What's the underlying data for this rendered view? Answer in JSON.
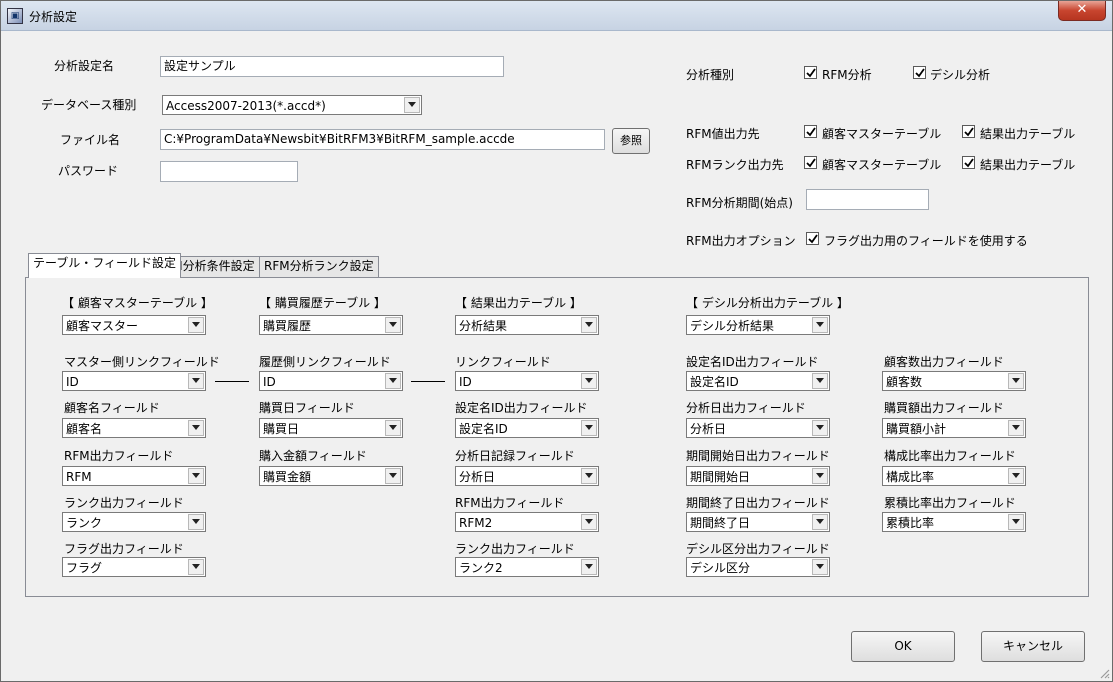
{
  "window": {
    "title": "分析設定"
  },
  "top": {
    "analysis_name": {
      "label": "分析設定名",
      "value": "設定サンプル"
    },
    "db_type": {
      "label": "データベース種別",
      "value": "Access2007-2013(*.accd*)"
    },
    "file_name": {
      "label": "ファイル名",
      "value": "C:¥ProgramData¥Newsbit¥BitRFM3¥BitRFM_sample.accde",
      "browse_label": "参照"
    },
    "password": {
      "label": "パスワード",
      "value": ""
    }
  },
  "right": {
    "analysis_type": {
      "label": "分析種別",
      "options": [
        {
          "label": "RFM分析",
          "checked": true
        },
        {
          "label": "デシル分析",
          "checked": true
        }
      ]
    },
    "rfm_value_output": {
      "label": "RFM値出力先",
      "options": [
        {
          "label": "顧客マスターテーブル",
          "checked": true
        },
        {
          "label": "結果出力テーブル",
          "checked": true
        }
      ]
    },
    "rfm_rank_output": {
      "label": "RFMランク出力先",
      "options": [
        {
          "label": "顧客マスターテーブル",
          "checked": true
        },
        {
          "label": "結果出力テーブル",
          "checked": true
        }
      ]
    },
    "rfm_period": {
      "label": "RFM分析期間(始点)",
      "value": ""
    },
    "rfm_option": {
      "label": "RFM出力オプション",
      "checkbox_label": "フラグ出力用のフィールドを使用する",
      "checked": true
    }
  },
  "tabs": [
    {
      "label": "テーブル・フィールド設定",
      "active": true
    },
    {
      "label": "RFM分析条件設定",
      "active": false
    },
    {
      "label": "RFM分析ランク設定",
      "active": false
    }
  ],
  "columns": {
    "customer": {
      "header": "【 顧客マスターテーブル 】",
      "table": "顧客マスター",
      "fields": [
        {
          "label": "マスター側リンクフィールド",
          "value": "ID"
        },
        {
          "label": "顧客名フィールド",
          "value": "顧客名"
        },
        {
          "label": "RFM出力フィールド",
          "value": "RFM"
        },
        {
          "label": "ランク出力フィールド",
          "value": "ランク"
        },
        {
          "label": "フラグ出力フィールド",
          "value": "フラグ"
        }
      ]
    },
    "purchase": {
      "header": "【 購買履歴テーブル 】",
      "table": "購買履歴",
      "fields": [
        {
          "label": "履歴側リンクフィールド",
          "value": "ID"
        },
        {
          "label": "購買日フィールド",
          "value": "購買日"
        },
        {
          "label": "購入金額フィールド",
          "value": "購買金額"
        }
      ]
    },
    "result": {
      "header": "【 結果出力テーブル 】",
      "table": "分析結果",
      "fields": [
        {
          "label": "リンクフィールド",
          "value": "ID"
        },
        {
          "label": "設定名ID出力フィールド",
          "value": "設定名ID"
        },
        {
          "label": "分析日記録フィールド",
          "value": "分析日"
        },
        {
          "label": "RFM出力フィールド",
          "value": "RFM2"
        },
        {
          "label": "ランク出力フィールド",
          "value": "ランク2"
        }
      ]
    },
    "decile": {
      "header": "【 デシル分析出力テーブル 】",
      "table": "デシル分析結果",
      "fields": [
        {
          "label": "設定名ID出力フィールド",
          "value": "設定名ID"
        },
        {
          "label": "分析日出力フィールド",
          "value": "分析日"
        },
        {
          "label": "期間開始日出力フィールド",
          "value": "期間開始日"
        },
        {
          "label": "期間終了日出力フィールド",
          "value": "期間終了日"
        },
        {
          "label": "デシル区分出力フィールド",
          "value": "デシル区分"
        }
      ]
    },
    "decile2": {
      "fields": [
        {
          "label": "顧客数出力フィールド",
          "value": "顧客数"
        },
        {
          "label": "購買額出力フィールド",
          "value": "購買額小計"
        },
        {
          "label": "構成比率出力フィールド",
          "value": "構成比率"
        },
        {
          "label": "累積比率出力フィールド",
          "value": "累積比率"
        }
      ]
    }
  },
  "buttons": {
    "ok": "OK",
    "cancel": "キャンセル"
  }
}
